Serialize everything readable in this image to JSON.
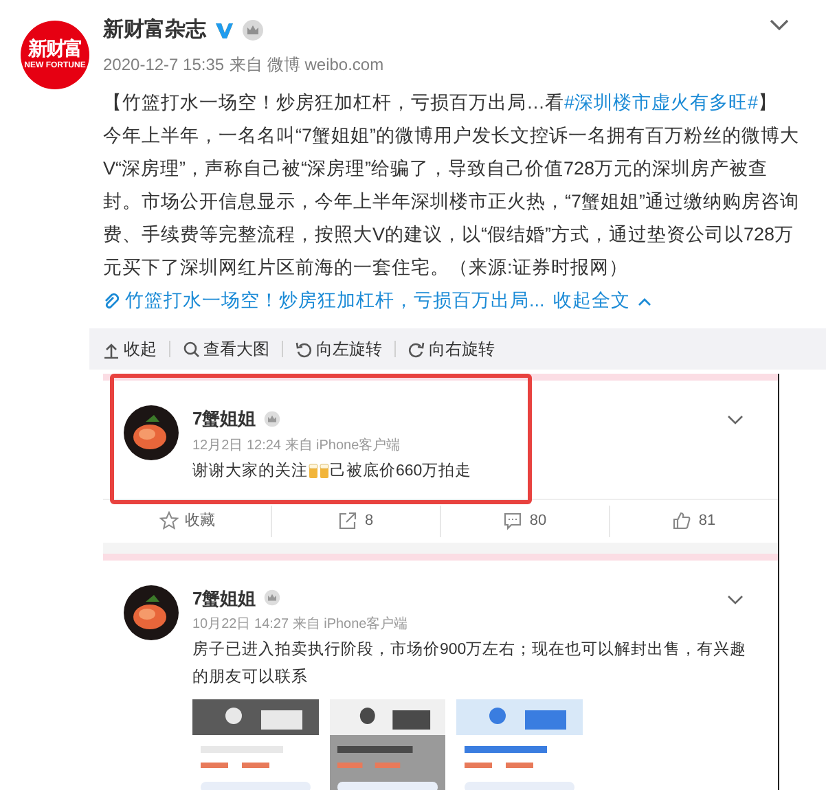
{
  "post": {
    "avatar": {
      "line1": "新财富",
      "line2": "NEW FORTUNE"
    },
    "author": "新财富杂志",
    "time": "2020-12-7 15:35",
    "source": "来自 微博 weibo.com",
    "headline": "【竹篮打水一场空！炒房狂加杠杆，亏损百万出局…看",
    "hashtag": "#深圳楼市虚火有多旺#",
    "headline_end": "】",
    "body": "今年上半年，一名名叫“7蟹姐姐”的微博用户发长文控诉一名拥有百万粉丝的微博大V“深房理”，声称自己被“深房理”给骗了，导致自己价值728万元的深圳房产被查封。市场公开信息显示，今年上半年深圳楼市正火热，“7蟹姐姐”通过缴纳购房咨询费、手续费等完整流程，按照大V的建议，以“假结婚”方式，通过垫资公司以728万元买下了深圳网红片区前海的一套住宅。（来源:证券时报网）",
    "link": "竹篮打水一场空！炒房狂加杠杆，亏损百万出局...",
    "collapse": "收起全文"
  },
  "image_toolbar": [
    {
      "kind": "collapse",
      "label": "收起"
    },
    {
      "kind": "zoom",
      "label": "查看大图"
    },
    {
      "kind": "rotate_left",
      "label": "向左旋转"
    },
    {
      "kind": "rotate_right",
      "label": "向右旋转"
    }
  ],
  "embedded_screenshot": {
    "posts": [
      {
        "author": "7蟹姐姐",
        "time": "12月2日 12:24 来自 iPhone客户端",
        "text": "谢谢大家的关注",
        "text_end": "己被底价660万拍走",
        "highlighted": true,
        "actions": [
          {
            "kind": "favorite",
            "label": "收藏"
          },
          {
            "kind": "repost",
            "label": "8"
          },
          {
            "kind": "comment",
            "label": "80"
          },
          {
            "kind": "like",
            "label": "81"
          }
        ]
      },
      {
        "author": "7蟹姐姐",
        "time": "10月22日 14:27 来自 iPhone客户端",
        "text": "房子已进入拍卖执行阶段，市场价900万左右；现在也可以解封出售，有兴趣的朋友可以联系",
        "highlighted": false
      }
    ]
  }
}
